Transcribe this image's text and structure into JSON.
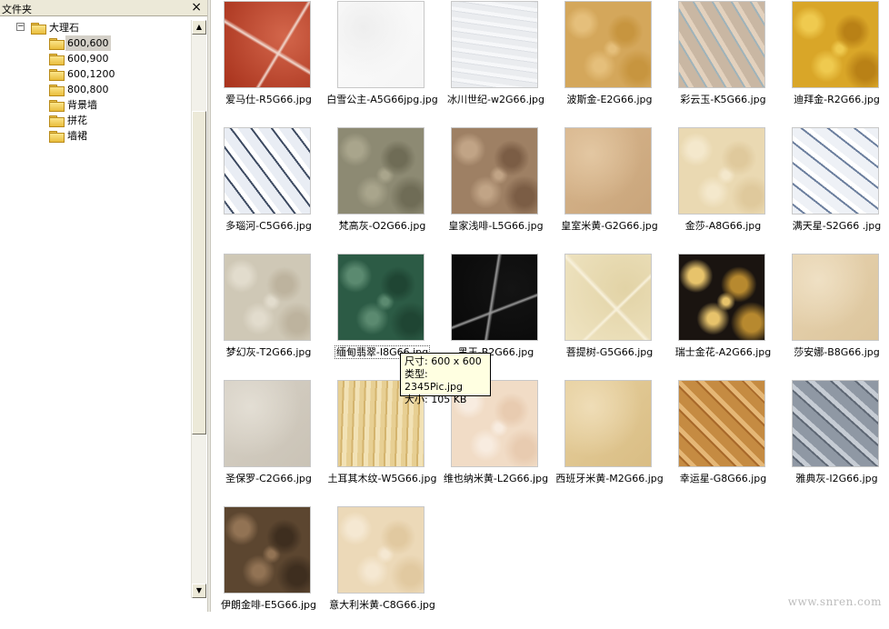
{
  "pane": {
    "title": "文件夹",
    "close_glyph": "×"
  },
  "tree": [
    {
      "label": "大理石",
      "level": 0,
      "expander": "−"
    },
    {
      "label": "600,600",
      "level": 1,
      "selected": true
    },
    {
      "label": "600,900",
      "level": 1
    },
    {
      "label": "600,1200",
      "level": 1
    },
    {
      "label": "800,800",
      "level": 1
    },
    {
      "label": "背景墙",
      "level": 1
    },
    {
      "label": "拼花",
      "level": 1
    },
    {
      "label": "墙裙",
      "level": 1
    }
  ],
  "scrollbar": {
    "up_glyph": "▲",
    "down_glyph": "▼"
  },
  "thumbnails": [
    {
      "caption": "爱马仕-R5G66.jpg",
      "colors": [
        "#a8321c",
        "#d3664b",
        "#f1d9cf"
      ],
      "kind": "veins"
    },
    {
      "caption": "白雪公主-A5G66jpg.jpg",
      "colors": [
        "#fcfcfc",
        "#f5f5f5",
        "#eeeeee"
      ],
      "kind": "plain"
    },
    {
      "caption": "冰川世纪-w2G66.jpg",
      "colors": [
        "#eaecef",
        "#dde0e5",
        "#f6f7f9"
      ],
      "kind": "lines"
    },
    {
      "caption": "波斯金-E2G66.jpg",
      "colors": [
        "#d4a75b",
        "#c7953f",
        "#e5bf7b"
      ],
      "kind": "mottle"
    },
    {
      "caption": "彩云玉-K5G66.jpg",
      "colors": [
        "#c9b7a3",
        "#9fb3ba",
        "#e3d1bd"
      ],
      "kind": "streaks"
    },
    {
      "caption": "迪拜金-R2G66.jpg",
      "colors": [
        "#d9a628",
        "#b98116",
        "#efca4f"
      ],
      "kind": "mottle"
    },
    {
      "caption": "多瑙河-C5G66.jpg",
      "colors": [
        "#e9edf4",
        "#3f4c63",
        "#ffffff"
      ],
      "kind": "streaks"
    },
    {
      "caption": "梵高灰-O2G66.jpg",
      "colors": [
        "#8d8a73",
        "#6f6c56",
        "#a9a58c"
      ],
      "kind": "mottle"
    },
    {
      "caption": "皇家浅啡-L5G66.jpg",
      "colors": [
        "#9e8064",
        "#7b5d45",
        "#c1a486"
      ],
      "kind": "mottle"
    },
    {
      "caption": "皇室米黄-G2G66.jpg",
      "colors": [
        "#d7b58c",
        "#c9a57b",
        "#e3c7a2"
      ],
      "kind": "plain"
    },
    {
      "caption": "金莎-A8G66.jpg",
      "colors": [
        "#ead9b2",
        "#dfc99c",
        "#f4e8cc"
      ],
      "kind": "mottle"
    },
    {
      "caption": "满天星-S2G66 .jpg",
      "colors": [
        "#eef1f6",
        "#6c7f9e",
        "#ffffff"
      ],
      "kind": "streaks"
    },
    {
      "caption": "梦幻灰-T2G66.jpg",
      "colors": [
        "#cfc8b6",
        "#bdb39e",
        "#e2dccd"
      ],
      "kind": "mottle"
    },
    {
      "caption": "缅甸翡翠-I8G66.jpg",
      "colors": [
        "#2c5b45",
        "#1f4533",
        "#5b8a70"
      ],
      "kind": "mottle",
      "focused": true
    },
    {
      "caption": "黑王-B2G66.jpg",
      "colors": [
        "#080808",
        "#141414",
        "#9a9a9a"
      ],
      "kind": "veins"
    },
    {
      "caption": "菩提树-G5G66.jpg",
      "colors": [
        "#efe4c2",
        "#e2d3a6",
        "#f8f1dc"
      ],
      "kind": "veins"
    },
    {
      "caption": "瑞士金花-A2G66.jpg",
      "colors": [
        "#1a1410",
        "#b7892f",
        "#e7c36b"
      ],
      "kind": "mottle"
    },
    {
      "caption": "莎安娜-B8G66.jpg",
      "colors": [
        "#e7d3b0",
        "#dcc59c",
        "#efe0c4"
      ],
      "kind": "plain"
    },
    {
      "caption": "圣保罗-C2G66.jpg",
      "colors": [
        "#d6d0c5",
        "#cac3b6",
        "#e3ded4"
      ],
      "kind": "plain"
    },
    {
      "caption": "土耳其木纹-W5G66.jpg",
      "colors": [
        "#e7cf93",
        "#d4b46e",
        "#f2e2b6"
      ],
      "kind": "lines-v"
    },
    {
      "caption": "维也纳米黄-L2G66.jpg",
      "colors": [
        "#f1dcc6",
        "#e8cbb0",
        "#f8ece0"
      ],
      "kind": "mottle"
    },
    {
      "caption": "西班牙米黄-M2G66.jpg",
      "colors": [
        "#e6cf9d",
        "#d9bd84",
        "#efddb7"
      ],
      "kind": "plain"
    },
    {
      "caption": "幸运星-G8G66.jpg",
      "colors": [
        "#c58b42",
        "#a8692a",
        "#e5b776"
      ],
      "kind": "streaks"
    },
    {
      "caption": "雅典灰-I2G66.jpg",
      "colors": [
        "#8f98a4",
        "#5e6774",
        "#c6ccd4"
      ],
      "kind": "streaks"
    },
    {
      "caption": "伊朗金啡-E5G66.jpg",
      "colors": [
        "#5c4630",
        "#3e2e1f",
        "#927354"
      ],
      "kind": "mottle"
    },
    {
      "caption": "意大利米黄-C8G66.jpg",
      "colors": [
        "#ecd9b8",
        "#e1c9a0",
        "#f5e8d2"
      ],
      "kind": "mottle"
    }
  ],
  "tooltip": {
    "line1": "尺寸: 600 x 600",
    "line2": "类型: 2345Pic.jpg",
    "line3": "大小: 105 KB"
  },
  "watermark": "www.snren.com"
}
